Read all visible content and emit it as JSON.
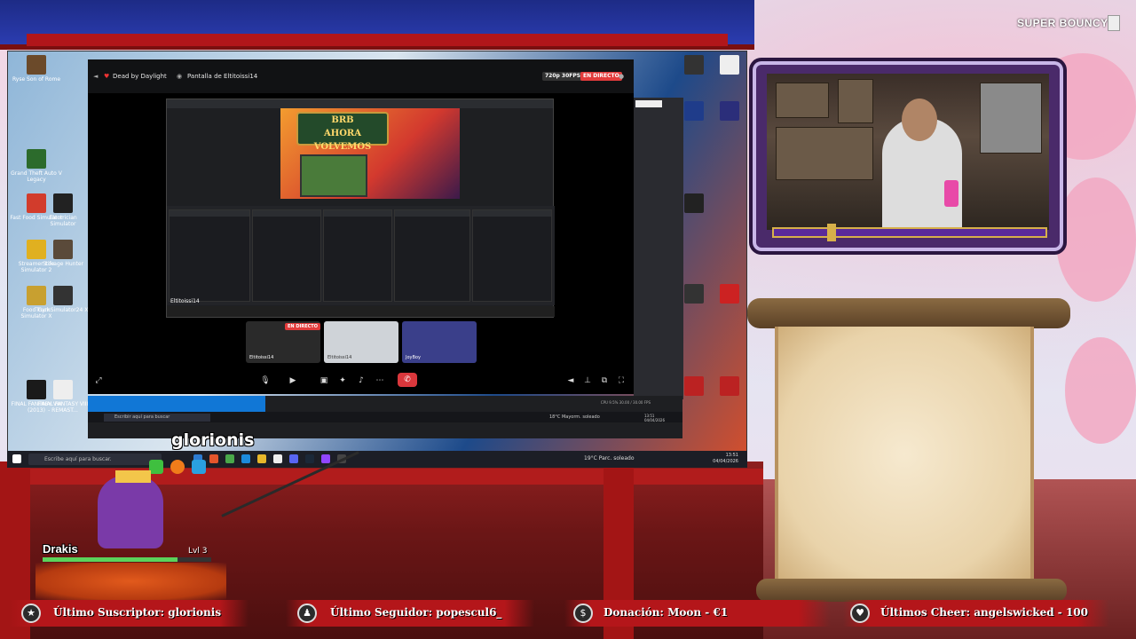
{
  "overlay": {
    "top_right_label": "SUPER BOUNCY",
    "chat_username": "glorionis",
    "pet": {
      "name": "Drakis",
      "level_label": "Lvl 3",
      "hp_fraction": 0.8
    },
    "banners": [
      {
        "label": "Último Suscriptor: glorionis",
        "icon": "star-icon"
      },
      {
        "label": "Último Seguidor: popescul6_",
        "icon": "user-icon"
      },
      {
        "label": "Donación: Moon - €1",
        "icon": "dollar-icon"
      },
      {
        "label": "Últimos Cheer: angelswicked - 100",
        "icon": "heart-icon"
      }
    ]
  },
  "desktop": {
    "icons_left": [
      "Ryse Son of Rome",
      "Grand Theft Auto V Legacy",
      "Fast Food Simulator",
      "Electrician Simulator",
      "Streamer Life Simulator 2",
      "Storage Hunter",
      "FoodTruck Simulator X",
      "GymSimulator24 X",
      "FINAL FANTASY VIII (2013)",
      "FINAL FANTASY VIII - REMAST..."
    ],
    "taskbar": {
      "search_placeholder": "Escribe aquí para buscar.",
      "weather": "19°C Parc. soleado",
      "time": "13:51",
      "date": "04/04/2026"
    }
  },
  "discord": {
    "channel_title": "Dead by Daylight",
    "stream_title": "Pantalla de Eltitoissi14",
    "quality_badge": "720p 30FPS",
    "live_badge": "EN DIRECTO",
    "inner_stream_label": "Eltitoissi14",
    "tiles": [
      {
        "name": "Eltitoissi14",
        "badge": "EN DIRECTO"
      },
      {
        "name": "Eltitoissi14",
        "badge": ""
      },
      {
        "name": "JoyBoy",
        "badge": ""
      }
    ],
    "preview_text": "AHORA VOLVEMOS",
    "preview_badge": "BRB"
  },
  "obs_window": {
    "search_placeholder": "Escribir aquí para buscar",
    "weather": "18°C Mayorm. soleado",
    "time": "13:51",
    "date": "04/04/2026",
    "status": "CPU 9.5%  30.00 / 30.00 FPS"
  },
  "colors": {
    "discord_red": "#da373c",
    "banner_red": "#b4161a",
    "live_red": "#e33c3c"
  }
}
